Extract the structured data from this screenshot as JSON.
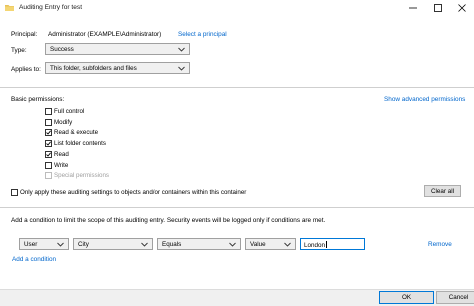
{
  "window": {
    "title": "Auditing Entry for test",
    "icon": "folder-icon"
  },
  "principal": {
    "label": "Principal:",
    "value": "Administrator (EXAMPLE\\Administrator)",
    "select_link": "Select a principal"
  },
  "type": {
    "label": "Type:",
    "value": "Success"
  },
  "applies_to": {
    "label": "Applies to:",
    "value": "This folder, subfolders and files"
  },
  "permissions": {
    "heading": "Basic permissions:",
    "advanced_link": "Show advanced permissions",
    "items": [
      {
        "label": "Full control",
        "checked": false,
        "disabled": false
      },
      {
        "label": "Modify",
        "checked": false,
        "disabled": false
      },
      {
        "label": "Read & execute",
        "checked": true,
        "disabled": false
      },
      {
        "label": "List folder contents",
        "checked": true,
        "disabled": false
      },
      {
        "label": "Read",
        "checked": true,
        "disabled": false
      },
      {
        "label": "Write",
        "checked": false,
        "disabled": false
      },
      {
        "label": "Special permissions",
        "checked": false,
        "disabled": true
      }
    ],
    "only_apply_label": "Only apply these auditing settings to objects and/or containers within this container",
    "only_apply_checked": false,
    "clear_all": "Clear all"
  },
  "condition": {
    "description": "Add a condition to limit the scope of this auditing entry. Security events will be logged only if conditions are met.",
    "row": {
      "attribute_source": "User",
      "attribute": "City",
      "operator": "Equals",
      "value_type": "Value",
      "value": "London"
    },
    "remove_link": "Remove",
    "add_link": "Add a condition"
  },
  "buttons": {
    "ok": "OK",
    "cancel": "Cancel"
  }
}
